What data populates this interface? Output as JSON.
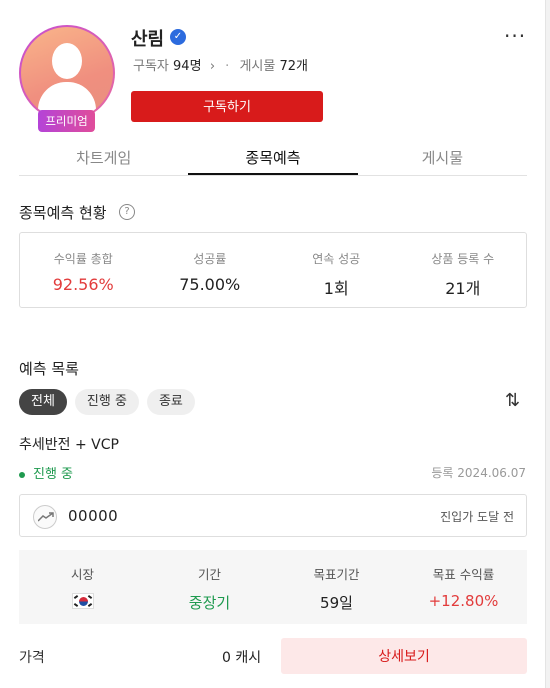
{
  "profile": {
    "name": "산림",
    "premium_badge": "프리미엄",
    "subscribers_label": "구독자",
    "subscribers_value": "94명",
    "posts_label": "게시물",
    "posts_value": "72개",
    "subscribe_button": "구독하기"
  },
  "tabs": [
    {
      "label": "차트게임",
      "active": false
    },
    {
      "label": "종목예측",
      "active": true
    },
    {
      "label": "게시물",
      "active": false
    }
  ],
  "summary": {
    "title": "종목예측 현황",
    "stats": [
      {
        "label": "수익률 총합",
        "value": "92.56%"
      },
      {
        "label": "성공률",
        "value": "75.00%"
      },
      {
        "label": "연속 성공",
        "value": "1회"
      },
      {
        "label": "상품 등록 수",
        "value": "21개"
      }
    ]
  },
  "predictions": {
    "title": "예측 목록",
    "filters": [
      "전체",
      "진행 중",
      "종료"
    ],
    "item": {
      "title": "추세반전 + VCP",
      "status": "진행 중",
      "registered": "등록  2024.06.07",
      "stock_name": "00000",
      "entry_status": "진입가 도달 전",
      "details": [
        {
          "label": "시장",
          "value": ""
        },
        {
          "label": "기간",
          "value": "중장기"
        },
        {
          "label": "목표기간",
          "value": "59일"
        },
        {
          "label": "목표 수익률",
          "value": "+12.80%"
        }
      ],
      "price_label": "가격",
      "price_value": "0 캐시",
      "detail_button": "상세보기"
    }
  },
  "colors": {
    "accent_red": "#d81b1b",
    "profit_red": "#e23b3b",
    "status_green": "#1f9a4f"
  }
}
